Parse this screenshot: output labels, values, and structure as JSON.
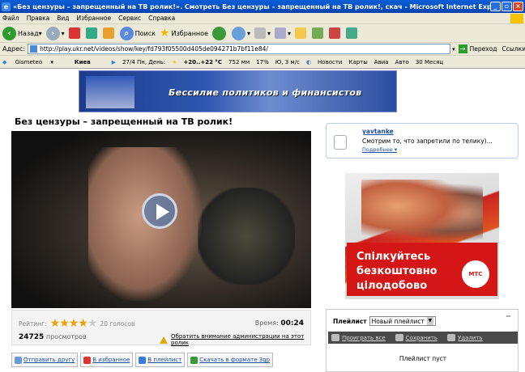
{
  "window": {
    "title": "«Без цензуры – запрещенный на ТВ ролик!». Смотреть Без цензуры – запрещенный на ТВ ролик!, скач - Microsoft Internet Explorer"
  },
  "menu": [
    "Файл",
    "Правка",
    "Вид",
    "Избранное",
    "Сервис",
    "Справка"
  ],
  "toolbar": {
    "back": "Назад",
    "search": "Поиск",
    "favorites": "Избранное"
  },
  "address": {
    "label": "Адрес:",
    "url": "http://play.ukr.net/videos/show/key/fd793f05500d405de094271b7bf11e84/",
    "go": "Переход",
    "links": "Ссылки"
  },
  "gisbar": {
    "gismeteo": "Gismeteo",
    "city": "Киев",
    "forecast": "27/4 Пн, День:",
    "temp": "+20..+22 °C",
    "pressure": "752 мм",
    "humidity": "17%",
    "wind": "Ю, 3 м/с",
    "news": "Новости",
    "maps": "Карты",
    "avia": "Авиа",
    "auto": "Авто",
    "month": "30 Месяц"
  },
  "banner": {
    "text": "Бессилие политиков и финансистов"
  },
  "page": {
    "title": "Без цензуры – запрещенный на ТВ ролик!"
  },
  "video": {
    "rating_label": "Рейтинг:",
    "rating": 4,
    "rating_max": 5,
    "votes": "20 голосов",
    "time_label": "Время:",
    "time": "00:24",
    "views_count": "24725",
    "views_label": "просмотров",
    "warn": "Обратить внимание администрации на этот ролик"
  },
  "actions": {
    "send": "Отправить другу",
    "fav": "В избранное",
    "playlist": "В плейлист",
    "download": "Скачать в формате 3gp"
  },
  "comment": {
    "user": "yavtanke",
    "text": "Смотрим то, что запретили по телику)...",
    "more": "Подробнее"
  },
  "ad": {
    "lines": [
      "Спілкуйтесь",
      "безкоштовно",
      "цілодобово"
    ],
    "brand": "МТС"
  },
  "playlist": {
    "label": "Плейлист",
    "select": "Новый плейлист",
    "play_all": "Проиграть все",
    "save": "Сохранить",
    "delete": "Удалить",
    "empty": "Плейлист пуст"
  },
  "colors": {
    "titlebar": "#0a5fd6",
    "link": "#1a4ea3",
    "ad_red": "#d41616",
    "star": "#f0a000"
  }
}
